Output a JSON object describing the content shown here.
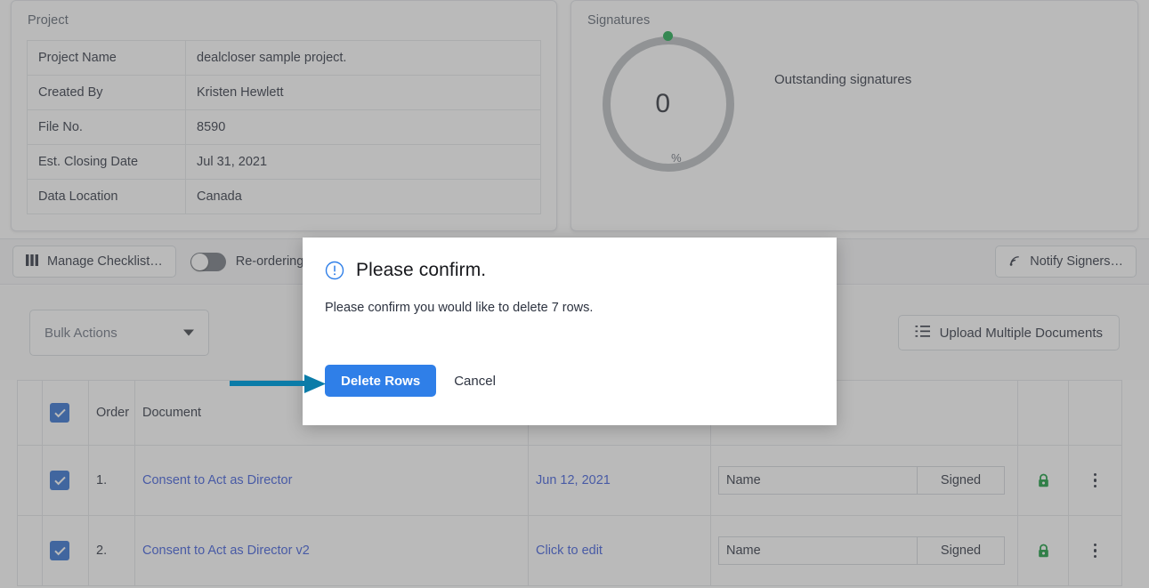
{
  "project_card": {
    "title": "Project",
    "rows": [
      {
        "label": "Project Name",
        "value": "dealcloser sample project."
      },
      {
        "label": "Created By",
        "value": "Kristen Hewlett"
      },
      {
        "label": "File No.",
        "value": "8590"
      },
      {
        "label": "Est. Closing Date",
        "value": "Jul 31, 2021"
      },
      {
        "label": "Data Location",
        "value": "Canada"
      }
    ]
  },
  "signatures_card": {
    "title": "Signatures",
    "percent": "0",
    "percent_symbol": "%",
    "legend": "Outstanding signatures",
    "dot_color": "#1ba94c",
    "ring_color": "#b9bcc0"
  },
  "toolbar": {
    "manage_checklist_label": "Manage Checklist…",
    "reordering_label": "Re-ordering (",
    "reordering_on": false,
    "notify_signers_label": "Notify Signers…"
  },
  "subbar": {
    "bulk_actions_label": "Bulk Actions",
    "upload_label": "Upload Multiple Documents"
  },
  "table": {
    "headers": {
      "drag": "",
      "check": "",
      "order": "Order",
      "document": "Document",
      "date": "",
      "signatures": "",
      "lock": "",
      "menu": ""
    },
    "select_all_checked": true,
    "rows": [
      {
        "checked": true,
        "order": "1.",
        "document": "Consent to Act as Director",
        "date": "Jun 12, 2021",
        "signature_name": "Name",
        "signature_state": "Signed",
        "lock": "locked",
        "menu": "more-options"
      },
      {
        "checked": true,
        "order": "2.",
        "document": "Consent to Act as Director v2",
        "date": "Click to edit",
        "signature_name": "Name",
        "signature_state": "Signed",
        "lock": "locked",
        "menu": "more-options"
      }
    ]
  },
  "modal": {
    "icon": "alert-circle-icon",
    "title": "Please confirm.",
    "message": "Please confirm you would like to delete 7 rows.",
    "confirm_label": "Delete Rows",
    "cancel_label": "Cancel",
    "confirm_color": "#2f7fe8"
  },
  "annotation": {
    "arrow_color": "#0b7ca8",
    "points_to": "Delete Rows"
  }
}
